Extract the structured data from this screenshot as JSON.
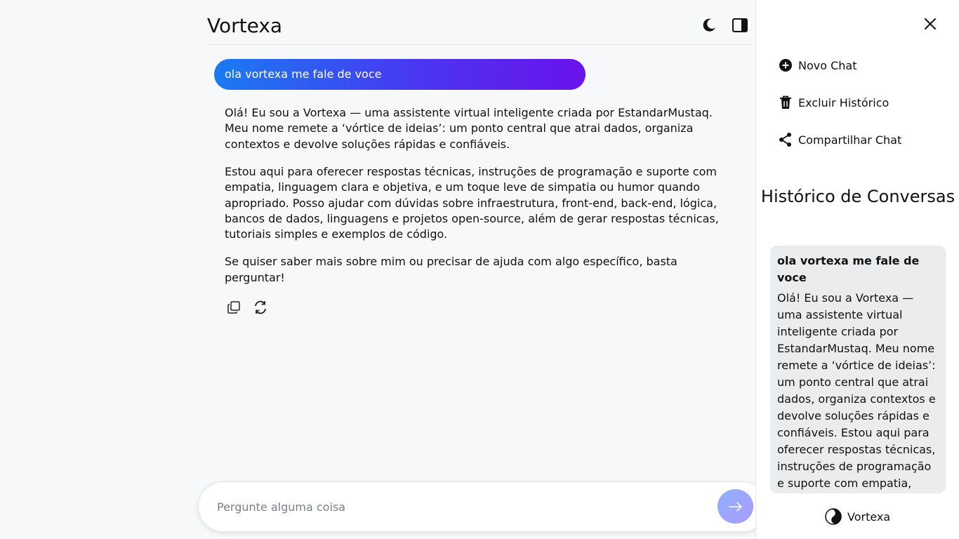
{
  "app": {
    "title": "Vortexa"
  },
  "chat": {
    "user_message": "ola vortexa me fale de voce",
    "assistant_paragraphs": [
      "Olá! Eu sou a Vortexa — uma assistente virtual inteligente criada por EstandarMustaq. Meu nome remete a ‘vórtice de ideias’: um ponto central que atrai dados, organiza contextos e devolve soluções rápidas e confiáveis.",
      "Estou aqui para oferecer respostas técnicas, instruções de programação e suporte com empatia, linguagem clara e objetiva, e um toque leve de simpatia ou humor quando apropriado. Posso ajudar com dúvidas sobre infraestrutura, front-end, back-end, lógica, bancos de dados, linguagens e projetos open-source, além de gerar respostas técnicas, tutoriais simples e exemplos de código.",
      "Se quiser saber mais sobre mim ou precisar de ajuda com algo específico, basta perguntar!"
    ]
  },
  "composer": {
    "placeholder": "Pergunte alguma coisa"
  },
  "sidebar": {
    "menu": {
      "new_chat": "Novo Chat",
      "delete_history": "Excluir Histórico",
      "share_chat": "Compartilhar Chat"
    },
    "history_title": "Histórico de Conversas",
    "history_items": [
      {
        "question": "ola vortexa me fale de voce",
        "preview": "Olá! Eu sou a Vortexa — uma assistente virtual inteligente criada por EstandarMustaq. Meu nome remete a ‘vórtice de ideias’: um ponto central que atrai dados, organiza contextos e devolve soluções rápidas e confiáveis. Estou aqui para oferecer respostas técnicas, instruções de programação e suporte com empatia,"
      }
    ],
    "brand": "Vortexa"
  },
  "colors": {
    "gradient_start": "#1a7bf2",
    "gradient_end": "#6a12ea",
    "send_button": "#a89cff"
  },
  "icons": [
    "moon-icon",
    "panel-toggle-icon",
    "copy-icon",
    "refresh-icon",
    "arrow-right-icon",
    "close-icon",
    "plus-circle-icon",
    "trash-icon",
    "share-icon",
    "yin-yang-icon"
  ]
}
